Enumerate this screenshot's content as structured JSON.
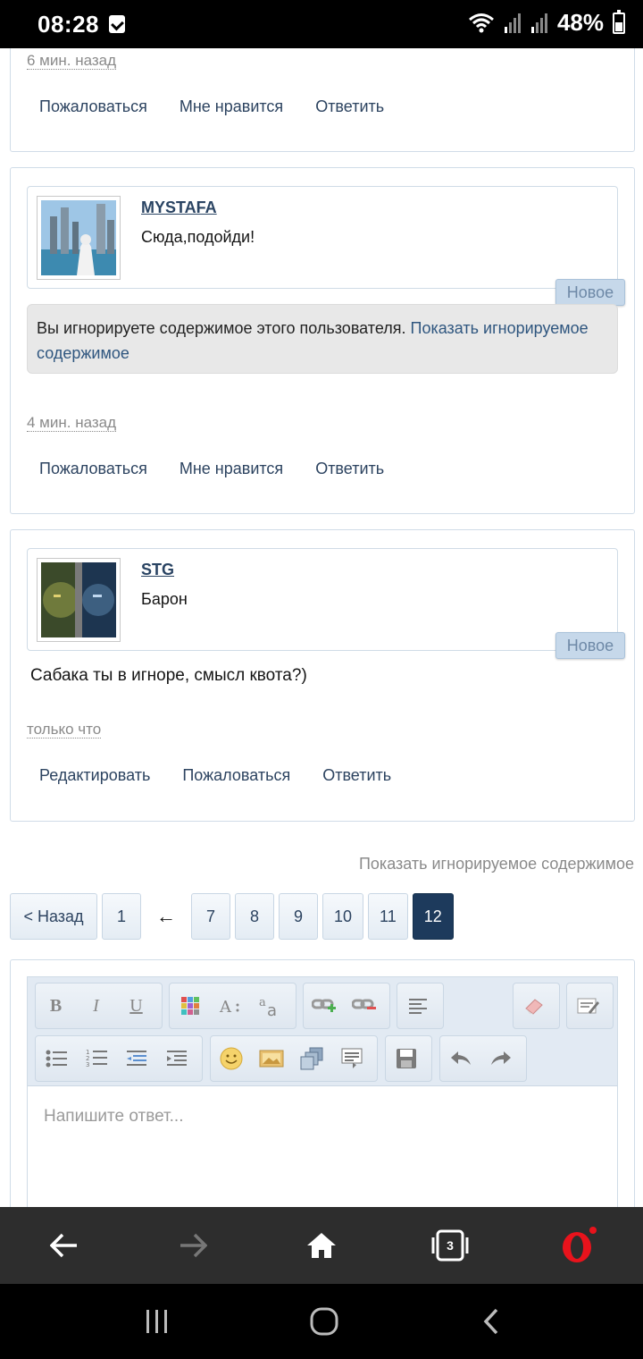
{
  "status": {
    "time": "08:28",
    "battery": "48%"
  },
  "posts": [
    {
      "time": "6 мин. назад",
      "actions": [
        "Пожаловаться",
        "Мне нравится",
        "Ответить"
      ]
    },
    {
      "username": "MYSTAFA",
      "usertitle": "Сюда,подойди!",
      "badge": "Новое",
      "ignored_text": "Вы игнорируете содержимое этого пользователя. ",
      "ignored_link": "Показать игнорируемое содержимое",
      "time": "4 мин. назад",
      "actions": [
        "Пожаловаться",
        "Мне нравится",
        "Ответить"
      ]
    },
    {
      "username": "STG",
      "usertitle": "Барон",
      "badge": "Новое",
      "message": "Сабака ты в игноре, смысл квота?)",
      "time": "только что",
      "actions": [
        "Редактировать",
        "Пожаловаться",
        "Ответить"
      ]
    }
  ],
  "show_ignored": "Показать игнорируемое содержимое",
  "pager": {
    "back": "< Назад",
    "first": "1",
    "arrow": "←",
    "pages": [
      "7",
      "8",
      "9",
      "10",
      "11"
    ],
    "current": "12"
  },
  "editor": {
    "placeholder": "Напишите ответ...",
    "bold": "B",
    "italic": "I",
    "underline": "U"
  },
  "browser": {
    "tabs_count": "3"
  },
  "colors": {
    "accent": "#1d3a5c",
    "link": "#2c4360",
    "badge": "#c6d8ea"
  }
}
